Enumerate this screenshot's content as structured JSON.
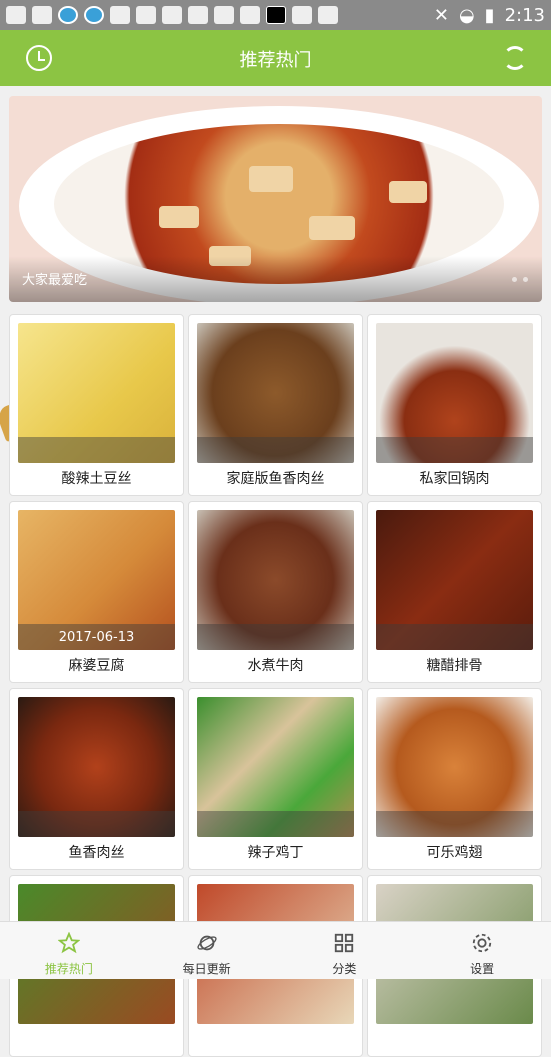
{
  "status_bar": {
    "time": "2:13"
  },
  "app_bar": {
    "title": "推荐热门",
    "left_icon": "clock-icon",
    "right_icon": "refresh-icon"
  },
  "banner": {
    "caption": "大家最爱吃"
  },
  "recipes": [
    {
      "label": "酸辣土豆丝",
      "date": ""
    },
    {
      "label": "家庭版鱼香肉丝",
      "date": ""
    },
    {
      "label": "私家回锅肉",
      "date": ""
    },
    {
      "label": "麻婆豆腐",
      "date": "2017-06-13"
    },
    {
      "label": "水煮牛肉",
      "date": ""
    },
    {
      "label": "糖醋排骨",
      "date": ""
    },
    {
      "label": "鱼香肉丝",
      "date": ""
    },
    {
      "label": "辣子鸡丁",
      "date": ""
    },
    {
      "label": "可乐鸡翅",
      "date": ""
    }
  ],
  "tabs": [
    {
      "label": "推荐热门",
      "icon": "star-icon",
      "active": true
    },
    {
      "label": "每日更新",
      "icon": "planet-icon",
      "active": false
    },
    {
      "label": "分类",
      "icon": "grid-icon",
      "active": false
    },
    {
      "label": "设置",
      "icon": "gear-icon",
      "active": false
    }
  ],
  "colors": {
    "accent": "#8cc443",
    "status_bar": "#8a8a8a"
  }
}
